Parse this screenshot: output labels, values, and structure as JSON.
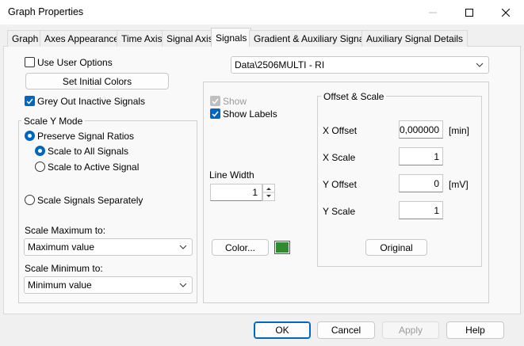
{
  "window": {
    "title": "Graph Properties"
  },
  "tabs": [
    {
      "label": "Graph"
    },
    {
      "label": "Axes Appearance"
    },
    {
      "label": "Time Axis"
    },
    {
      "label": "Signal Axis"
    },
    {
      "label": "Signals"
    },
    {
      "label": "Gradient & Auxiliary Signals"
    },
    {
      "label": "Auxiliary Signal Details"
    }
  ],
  "left": {
    "use_user_options": "Use User Options",
    "set_initial_colors": "Set Initial Colors",
    "grey_out_inactive": "Grey Out Inactive Signals",
    "scale_y_mode": {
      "title": "Scale Y Mode",
      "preserve_ratios": "Preserve Signal Ratios",
      "scale_to_all": "Scale to All Signals",
      "scale_to_active": "Scale to Active Signal",
      "scale_separately": "Scale Signals Separately",
      "scale_max_label": "Scale Maximum to:",
      "scale_max_value": "Maximum value",
      "scale_min_label": "Scale Minimum to:",
      "scale_min_value": "Minimum value"
    }
  },
  "right": {
    "signal_select": "Data\\2506MULTI - RI",
    "show": "Show",
    "show_labels": "Show Labels",
    "line_width_label": "Line Width",
    "line_width_value": "1",
    "color_button": "Color...",
    "color_swatch": "#2e8b2e",
    "offset_scale": {
      "title": "Offset & Scale",
      "x_offset_label": "X Offset",
      "x_offset_value": "0,000000",
      "x_offset_unit": "[min]",
      "x_scale_label": "X Scale",
      "x_scale_value": "1",
      "y_offset_label": "Y Offset",
      "y_offset_value": "0",
      "y_offset_unit": "[mV]",
      "y_scale_label": "Y Scale",
      "y_scale_value": "1",
      "original_button": "Original"
    }
  },
  "footer": {
    "ok": "OK",
    "cancel": "Cancel",
    "apply": "Apply",
    "help": "Help"
  },
  "colors": {
    "accent": "#0067c0"
  }
}
